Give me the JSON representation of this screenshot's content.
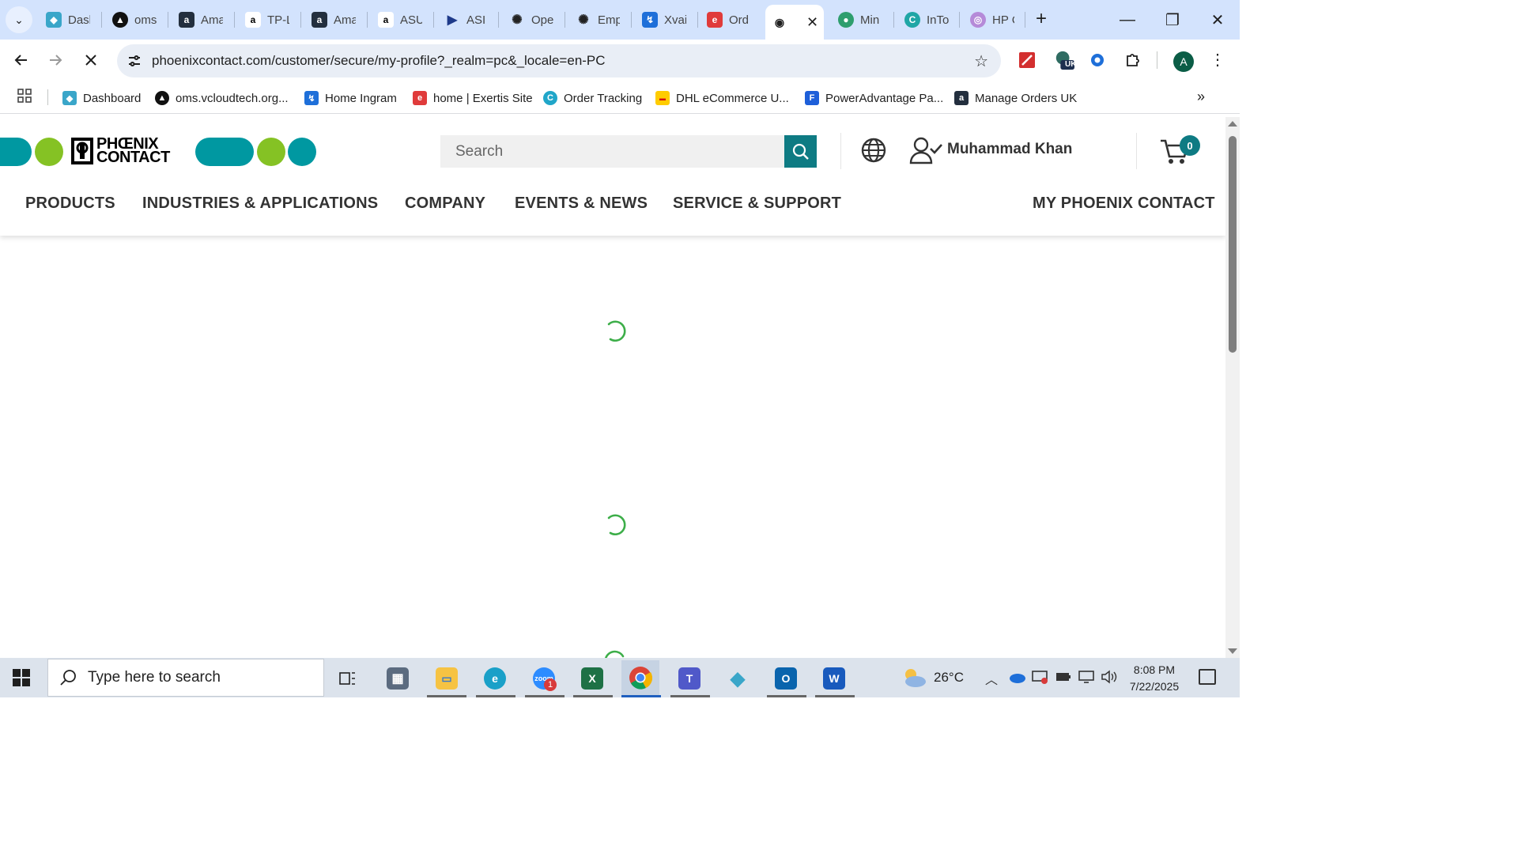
{
  "browser": {
    "tabs": [
      {
        "title": "Dasl",
        "color": "#3aa6c9",
        "glyph": "◆"
      },
      {
        "title": "oms",
        "color": "#111111",
        "glyph": "▲"
      },
      {
        "title": "Ama",
        "color": "#232f3e",
        "glyph": "a"
      },
      {
        "title": "TP-L",
        "color": "#ffffff",
        "glyph": "a"
      },
      {
        "title": "Ama",
        "color": "#232f3e",
        "glyph": "a"
      },
      {
        "title": "ASU",
        "color": "#ffffff",
        "glyph": "a"
      },
      {
        "title": "ASI",
        "color": "#ffffff",
        "glyph": "▶"
      },
      {
        "title": "Ope",
        "color": "#ffffff",
        "glyph": "✺"
      },
      {
        "title": "Emp",
        "color": "#ffffff",
        "glyph": "✺"
      },
      {
        "title": "Xvai",
        "color": "#ffffff",
        "glyph": "↯"
      },
      {
        "title": "Ord",
        "color": "#e03b3b",
        "glyph": "e"
      },
      {
        "title": "",
        "color": "#ffffff",
        "glyph": "◉"
      },
      {
        "title": "Min",
        "color": "#2e9e6e",
        "glyph": "●"
      },
      {
        "title": "InTo",
        "color": "#20a6a6",
        "glyph": "C"
      },
      {
        "title": "HP C",
        "color": "#b58ad8",
        "glyph": "◎"
      }
    ],
    "url": "phoenixcontact.com/customer/secure/my-profile?_realm=pc&_locale=en-PC",
    "profile_initial": "A",
    "extension_badge": "UK",
    "bookmarks": [
      {
        "label": "Dashboard",
        "color": "#3aa6c9",
        "glyph": "◆"
      },
      {
        "label": "oms.vcloudtech.org...",
        "color": "#111111",
        "glyph": "▲"
      },
      {
        "label": "Home Ingram",
        "color": "#1e6fd9",
        "glyph": "↯"
      },
      {
        "label": "home | Exertis Site",
        "color": "#e03b3b",
        "glyph": "e"
      },
      {
        "label": "Order Tracking",
        "color": "#20a6c9",
        "glyph": "C"
      },
      {
        "label": "DHL eCommerce U...",
        "color": "#ffcc00",
        "glyph": "▬"
      },
      {
        "label": "PowerAdvantage Pa...",
        "color": "#1e5fd9",
        "glyph": "F"
      },
      {
        "label": "Manage Orders UK",
        "color": "#232f3e",
        "glyph": "a"
      }
    ]
  },
  "site": {
    "logo_line1": "PHŒNIX",
    "logo_line2": "CONTACT",
    "search_placeholder": "Search",
    "user_name": "Muhammad Khan",
    "cart_count": "0",
    "nav": [
      "PRODUCTS",
      "INDUSTRIES & APPLICATIONS",
      "COMPANY",
      "EVENTS & NEWS",
      "SERVICE & SUPPORT",
      "MY PHOENIX CONTACT"
    ],
    "colors": {
      "teal": "#0098a1",
      "green": "#85c224",
      "dark_teal": "#0e7b83",
      "spinner": "#3dae49"
    }
  },
  "taskbar": {
    "search_placeholder": "Type here to search",
    "temperature": "26°C",
    "time": "8:08 PM",
    "date": "7/22/2025",
    "zoom_badge": "1"
  }
}
